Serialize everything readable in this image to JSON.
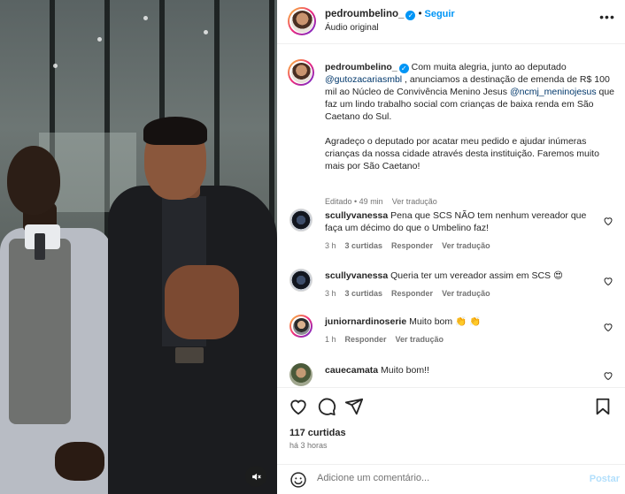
{
  "post": {
    "username": "pedroumbelino_",
    "follow_label": "Seguir",
    "dot": "•",
    "audio_label": "Áudio original",
    "more_icon": "more-horizontal-icon"
  },
  "caption": {
    "username": "pedroumbelino_",
    "part1": " Com muita alegria, junto ao deputado ",
    "mention1": "@gutozacariasmbl",
    "part2": " , anunciamos a destinação de emenda de R$ 100 mil ao Núcleo de Convivência Menino Jesus ",
    "mention2": "@ncmj_meninojesus",
    "part3": " que faz um lindo trabalho social com crianças de baixa renda em São Caetano do Sul.\n\nAgradeço o deputado por acatar meu pedido e ajudar inúmeras crianças da nossa cidade através desta instituição. Faremos muito mais por São Caetano!",
    "edited": "Editado • 49 min",
    "translate": "Ver tradução"
  },
  "comments": [
    {
      "user": "scullyvanessa",
      "text": "Pena que SCS NÃO tem nenhum vereador que faça um décimo do que o Umbelino faz!",
      "time": "3 h",
      "likes": "3 curtidas",
      "reply": "Responder",
      "translate": "Ver tradução"
    },
    {
      "user": "scullyvanessa",
      "text": "Queria ter um vereador assim em SCS 😍",
      "time": "3 h",
      "likes": "3 curtidas",
      "reply": "Responder",
      "translate": "Ver tradução"
    },
    {
      "user": "juniornardinoserie",
      "text": "Muito bom 👏 👏",
      "time": "1 h",
      "likes": "",
      "reply": "Responder",
      "translate": "Ver tradução"
    },
    {
      "user": "cauecamata",
      "text": "Muito bom!!",
      "time": "",
      "likes": "",
      "reply": "",
      "translate": ""
    }
  ],
  "footer": {
    "likes": "117 curtidas",
    "time_ago": "há 3 horas",
    "comment_placeholder": "Adicione um comentário...",
    "post_label": "Postar"
  },
  "colors": {
    "link_blue": "#0095f6",
    "mention": "#00376b",
    "muted": "#737373"
  }
}
